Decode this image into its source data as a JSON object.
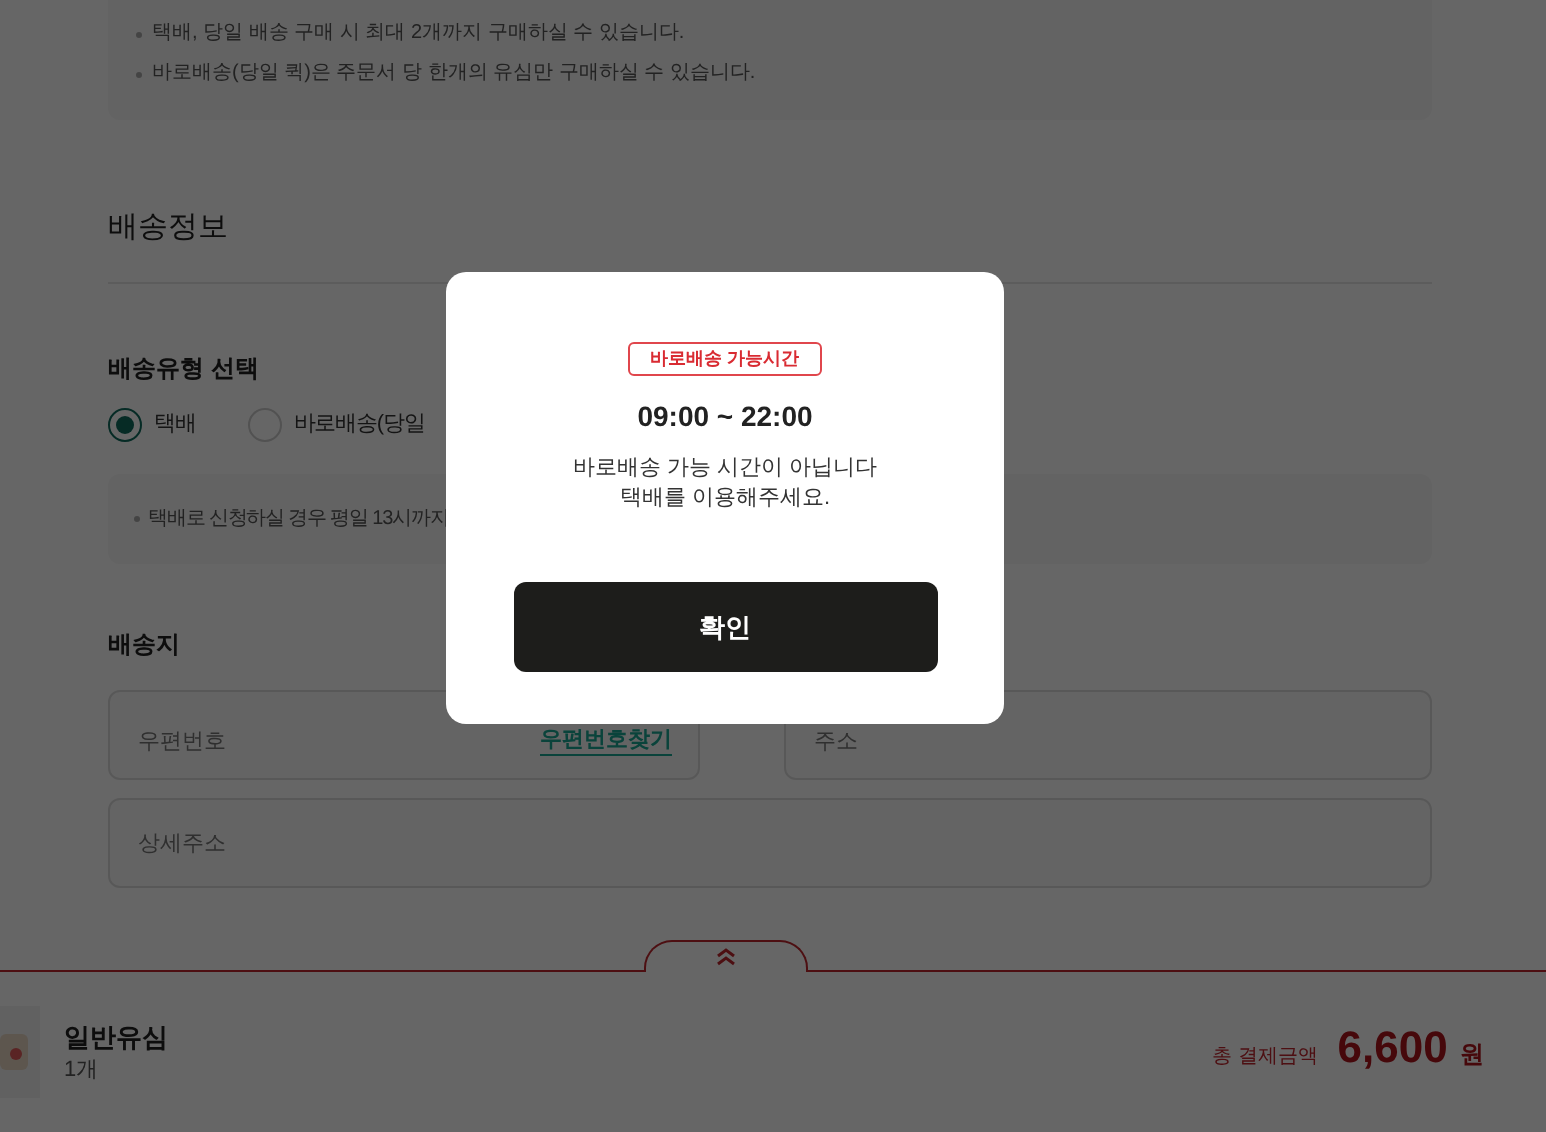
{
  "notice_box": {
    "items": [
      "택배, 당일 배송 구매 시 최대 2개까지 구매하실 수 있습니다.",
      "바로배송(당일 퀵)은 주문서 당 한개의 유심만 구매하실 수 있습니다."
    ]
  },
  "section_title": "배송정보",
  "delivery_type": {
    "label": "배송유형 선택",
    "options": [
      {
        "label": "택배",
        "selected": true
      },
      {
        "label": "바로배송(당일",
        "selected": false
      }
    ],
    "note": "택배로 신청하실 경우 평일 13시까지"
  },
  "address": {
    "label": "배송지",
    "postcode": {
      "placeholder": "우편번호"
    },
    "postcode_link": "우편번호찾기",
    "address": {
      "placeholder": "주소"
    },
    "detail": {
      "placeholder": "상세주소"
    }
  },
  "bottom_bar": {
    "product_name": "일반유심",
    "quantity": "1개",
    "total_label": "총 결제금액",
    "total": "6,600",
    "currency": "원"
  },
  "modal": {
    "badge": "바로배송 가능시간",
    "hours": "09:00 ~ 22:00",
    "message_lines": [
      "바로배송 가능 시간이 아닙니다",
      "택배를 이용해주세요."
    ],
    "confirm": "확인"
  }
}
